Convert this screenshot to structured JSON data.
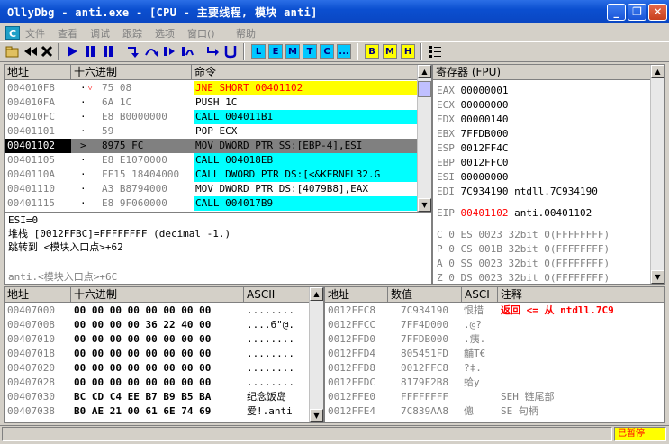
{
  "window": {
    "title": "OllyDbg - anti.exe - [CPU - 主要线程, 模块 anti]",
    "minimize": "_",
    "restore": "❐",
    "close": "✕"
  },
  "menu": {
    "c_label": "C",
    "items": [
      "文件",
      "查看",
      "调试",
      "跟踪",
      "选项",
      "窗口()",
      "帮助"
    ]
  },
  "toolbar": {
    "icons": [
      "open-icon",
      "rewind-icon",
      "close-proc-icon",
      "run-icon",
      "pause-icon",
      "step-into-icon",
      "step-over-icon",
      "trace-into-icon",
      "trace-over-icon",
      "exec-till-return-icon",
      "go-to-user-code-icon"
    ],
    "letters1": [
      "L",
      "E",
      "M",
      "T",
      "C",
      "..."
    ],
    "letters2": [
      "B",
      "M",
      "H"
    ],
    "list_icon": "list-icon"
  },
  "cpu": {
    "headers": {
      "address": "地址",
      "hex": "十六进制",
      "command": "命令"
    },
    "rows": [
      {
        "addr": "004010F8",
        "mark": "·",
        "arrow": "˅",
        "hex": "75 08",
        "cmd": "JNE SHORT 00401102",
        "style": "yellow"
      },
      {
        "addr": "004010FA",
        "mark": "·",
        "arrow": "",
        "hex": "6A 1C",
        "cmd": "PUSH 1C",
        "style": ""
      },
      {
        "addr": "004010FC",
        "mark": "·",
        "arrow": "",
        "hex": "E8 B0000000",
        "cmd": "CALL 004011B1",
        "style": "cyan"
      },
      {
        "addr": "00401101",
        "mark": "·",
        "arrow": "",
        "hex": "59",
        "cmd": "POP ECX",
        "style": ""
      },
      {
        "addr": "00401102",
        "mark": ">",
        "arrow": "",
        "hex": "8975 FC",
        "cmd": "MOV DWORD PTR SS:[EBP-4],ESI",
        "style": "selected"
      },
      {
        "addr": "00401105",
        "mark": "·",
        "arrow": "",
        "hex": "E8 E1070000",
        "cmd": "CALL 004018EB",
        "style": "cyan"
      },
      {
        "addr": "0040110A",
        "mark": "·",
        "arrow": "",
        "hex": "FF15 18404000",
        "cmd": "CALL DWORD PTR DS:[<&KERNEL32.G",
        "style": "cyan"
      },
      {
        "addr": "00401110",
        "mark": "·",
        "arrow": "",
        "hex": "A3 B8794000",
        "cmd": "MOV DWORD PTR DS:[4079B8],EAX",
        "style": ""
      },
      {
        "addr": "00401115",
        "mark": "·",
        "arrow": "",
        "hex": "E8 9F060000",
        "cmd": "CALL 004017B9",
        "style": "cyan"
      }
    ]
  },
  "registers": {
    "header": "寄存器 (FPU)",
    "gp": [
      {
        "name": "EAX",
        "value": "00000001",
        "comment": ""
      },
      {
        "name": "ECX",
        "value": "00000000",
        "comment": ""
      },
      {
        "name": "EDX",
        "value": "00000140",
        "comment": ""
      },
      {
        "name": "EBX",
        "value": "7FFDB000",
        "comment": ""
      },
      {
        "name": "ESP",
        "value": "0012FF4C",
        "comment": ""
      },
      {
        "name": "EBP",
        "value": "0012FFC0",
        "comment": ""
      },
      {
        "name": "ESI",
        "value": "00000000",
        "comment": ""
      },
      {
        "name": "EDI",
        "value": "7C934190",
        "comment": "ntdll.7C934190"
      }
    ],
    "eip": {
      "name": "EIP",
      "value": "00401102",
      "comment": "anti.00401102"
    },
    "flags": [
      {
        "f": "C 0",
        "seg": "ES 0023 32bit 0(FFFFFFFF)"
      },
      {
        "f": "P 0",
        "seg": "CS 001B 32bit 0(FFFFFFFF)"
      },
      {
        "f": "A 0",
        "seg": "SS 0023 32bit 0(FFFFFFFF)"
      },
      {
        "f": "Z 0",
        "seg": "DS 0023 32bit 0(FFFFFFFF)"
      }
    ]
  },
  "info": {
    "line1": "ESI=0",
    "line2": "堆栈 [0012FFBC]=FFFFFFFF (decimal -1.)",
    "line3": "跳转到 <模块入口点>+62",
    "line4": "anti.<模块入口点>+6C"
  },
  "dump": {
    "headers": {
      "address": "地址",
      "hex": "十六进制",
      "ascii": "ASCII"
    },
    "rows": [
      {
        "addr": "00407000",
        "hex": "00 00 00 00 00 00 00 00",
        "ascii": "........"
      },
      {
        "addr": "00407008",
        "hex": "00 00 00 00 36 22 40 00",
        "ascii": "....6\"@."
      },
      {
        "addr": "00407010",
        "hex": "00 00 00 00 00 00 00 00",
        "ascii": "........"
      },
      {
        "addr": "00407018",
        "hex": "00 00 00 00 00 00 00 00",
        "ascii": "........"
      },
      {
        "addr": "00407020",
        "hex": "00 00 00 00 00 00 00 00",
        "ascii": "........"
      },
      {
        "addr": "00407028",
        "hex": "00 00 00 00 00 00 00 00",
        "ascii": "........"
      },
      {
        "addr": "00407030",
        "hex": "BC CD C4 EE B7 B9 B5 BA",
        "ascii": "纪念饭岛"
      },
      {
        "addr": "00407038",
        "hex": "B0 AE 21 00 61 6E 74 69",
        "ascii": "爱!.anti"
      }
    ]
  },
  "stack": {
    "headers": {
      "address": "地址",
      "value": "数值",
      "ascii": "ASCI",
      "comment": "注释"
    },
    "rows": [
      {
        "addr": "0012FFC8",
        "value": "7C934190",
        "ascii": "恨措",
        "comment": "返回 <= 从 ntdll.7C9",
        "comment_red": true
      },
      {
        "addr": "0012FFCC",
        "value": "7FF4D000",
        "ascii": ".@?",
        "comment": "",
        "comment_red": false
      },
      {
        "addr": "0012FFD0",
        "value": "7FFDB000",
        "ascii": ".痍.",
        "comment": "",
        "comment_red": false
      },
      {
        "addr": "0012FFD4",
        "value": "805451FD",
        "ascii": "黼T€",
        "comment": "",
        "comment_red": false
      },
      {
        "addr": "0012FFD8",
        "value": "0012FFC8",
        "ascii": "?‡.",
        "comment": "",
        "comment_red": false
      },
      {
        "addr": "0012FFDC",
        "value": "8179F2B8",
        "ascii": "蛤y",
        "comment": "",
        "comment_red": false
      },
      {
        "addr": "0012FFE0",
        "value": "FFFFFFFF",
        "ascii": "",
        "comment": "SEH 链尾部",
        "comment_red": false
      },
      {
        "addr": "0012FFE4",
        "value": "7C839AA8",
        "ascii": "  傯",
        "comment": "SE 句柄",
        "comment_red": false
      }
    ]
  },
  "status": {
    "paused": "已暂停"
  }
}
